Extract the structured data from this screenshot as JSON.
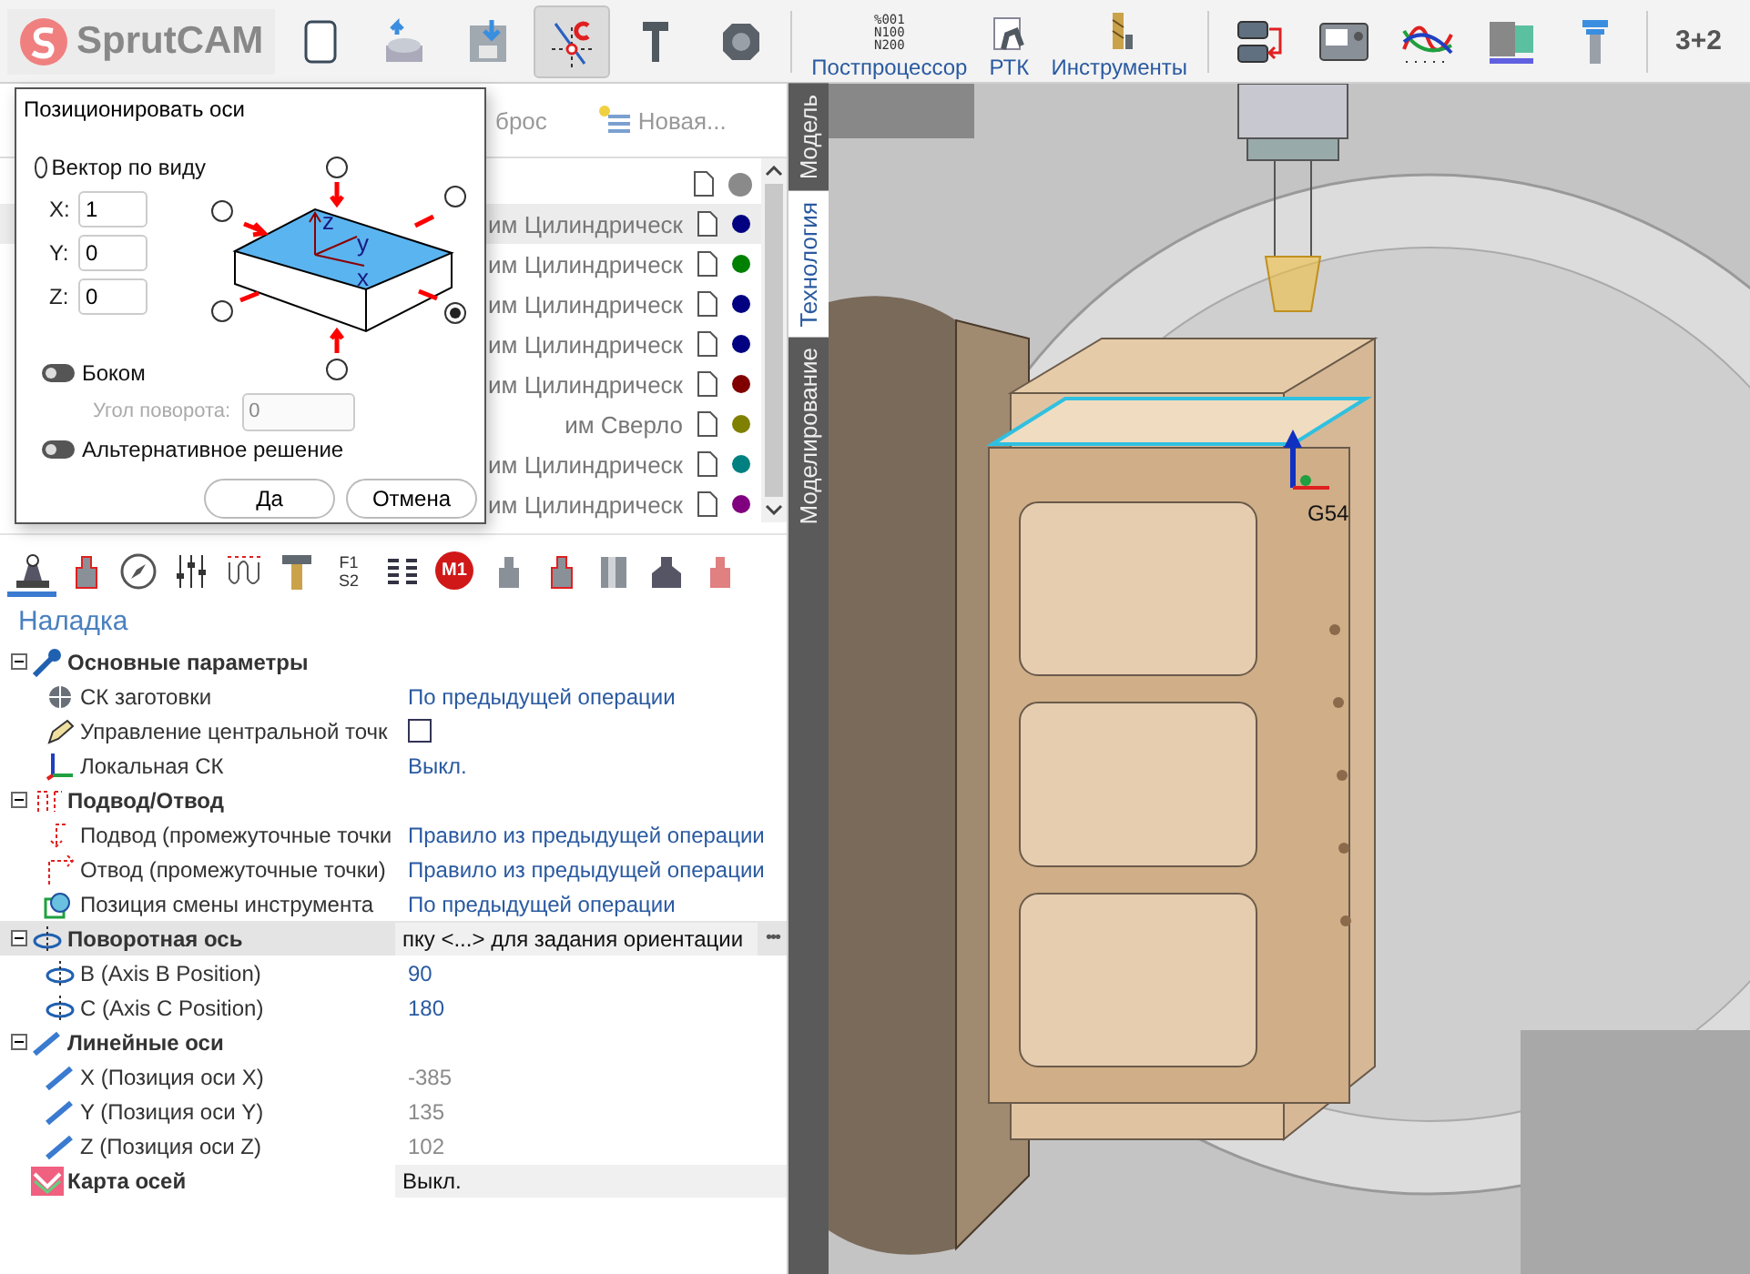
{
  "toolbar": {
    "logo": "SprutCAM",
    "tools": [
      {
        "kind": "new",
        "selected": false
      },
      {
        "kind": "open",
        "selected": false
      },
      {
        "kind": "save",
        "selected": false
      },
      {
        "kind": "snap",
        "selected": true
      },
      {
        "kind": "caliper",
        "selected": false
      },
      {
        "kind": "tape",
        "selected": false
      }
    ],
    "labeled": [
      {
        "kind": "post",
        "label": "Постпроцессор",
        "icon_lines": [
          "%001",
          "N100",
          "N200"
        ]
      },
      {
        "kind": "rtk",
        "label": "РТК"
      },
      {
        "kind": "tools",
        "label": "Инструменты"
      }
    ],
    "right_tools": [
      {
        "kind": "swap"
      },
      {
        "kind": "cnc"
      },
      {
        "kind": "curves"
      },
      {
        "kind": "spectrum"
      },
      {
        "kind": "tool"
      }
    ],
    "mode": "3+2"
  },
  "operations_panel": {
    "reset_label": "брос",
    "new_label": "Новая...",
    "header": {
      "color": "#8a8a8a"
    },
    "rows": [
      {
        "name": "им Цилиндрическ",
        "color": "#000080",
        "selected": true
      },
      {
        "name": "им Цилиндрическ",
        "color": "#008000",
        "selected": false
      },
      {
        "name": "им Цилиндрическ",
        "color": "#000080",
        "selected": false
      },
      {
        "name": "им Цилиндрическ",
        "color": "#000080",
        "selected": false
      },
      {
        "name": "им Цилиндрическ",
        "color": "#800000",
        "selected": false
      },
      {
        "name": "им Сверло",
        "color": "#808000",
        "selected": false
      },
      {
        "name": "им Цилиндрическ",
        "color": "#008080",
        "selected": false
      },
      {
        "name": "им Цилиндрическ",
        "color": "#800080",
        "selected": false
      }
    ]
  },
  "dialog": {
    "title": "Позиционировать оси",
    "view_vector": {
      "label": "Вектор по виду",
      "selected": false
    },
    "fields": [
      {
        "label": "X:",
        "value": "1"
      },
      {
        "label": "Y:",
        "value": "0"
      },
      {
        "label": "Z:",
        "value": "0"
      }
    ],
    "axis_labels": [
      "z",
      "y",
      "x"
    ],
    "directions": [
      {
        "selected": false
      },
      {
        "selected": false
      },
      {
        "selected": false
      },
      {
        "selected": false
      },
      {
        "selected": true
      },
      {
        "selected": false
      }
    ],
    "side": {
      "label": "Боком",
      "on": false
    },
    "angle": {
      "label": "Угол поворота:",
      "value": "0",
      "disabled": true
    },
    "alternative": {
      "label": "Альтернативное решение",
      "on": false
    },
    "buttons": [
      "Да",
      "Отмена"
    ]
  },
  "param_tabs": [
    {
      "selected": true
    },
    {
      "selected": false
    },
    {
      "selected": false
    },
    {
      "selected": false
    },
    {
      "selected": false
    },
    {
      "selected": false
    },
    {
      "selected": false,
      "labels": [
        "F1",
        "S2"
      ]
    },
    {
      "selected": false
    },
    {
      "selected": false,
      "labels": [
        "M1"
      ]
    },
    {
      "selected": false
    },
    {
      "selected": false
    },
    {
      "selected": false
    },
    {
      "selected": false
    },
    {
      "selected": false
    }
  ],
  "section_title": "Наладка",
  "properties": [
    {
      "kind": "group",
      "name": "Основные параметры",
      "expanded": true,
      "selected": false,
      "children": [
        {
          "name": "СК заготовки",
          "kind": "text",
          "value": "По предыдущей операции",
          "disabled": false
        },
        {
          "name": "Управление центральной точк",
          "kind": "checkbox",
          "checked": false
        },
        {
          "name": "Локальная СК",
          "kind": "text",
          "value": "Выкл.",
          "disabled": false
        }
      ]
    },
    {
      "kind": "group",
      "name": "Подвод/Отвод",
      "expanded": true,
      "selected": false,
      "children": [
        {
          "name": "Подвод (промежуточные точки",
          "kind": "text",
          "value": "Правило из предыдущей операции",
          "disabled": false
        },
        {
          "name": "Отвод (промежуточные точки)",
          "kind": "text",
          "value": "Правило из предыдущей операции",
          "disabled": false
        },
        {
          "name": "Позиция смены инструмента",
          "kind": "text",
          "value": "По предыдущей операции",
          "disabled": false
        }
      ]
    },
    {
      "kind": "group",
      "name": "Поворотная ось",
      "expanded": true,
      "selected": true,
      "value": "пку <...> для задания ориентации",
      "action": "•••",
      "children": [
        {
          "name": "B (Axis B Position)",
          "kind": "text",
          "value": "90",
          "disabled": false
        },
        {
          "name": "C (Axis C Position)",
          "kind": "text",
          "value": "180",
          "disabled": false
        }
      ]
    },
    {
      "kind": "group",
      "name": "Линейные оси",
      "expanded": true,
      "selected": false,
      "children": [
        {
          "name": "X (Позиция оси X)",
          "kind": "text",
          "value": "-385",
          "disabled": true
        },
        {
          "name": "Y (Позиция оси Y)",
          "kind": "text",
          "value": "135",
          "disabled": true
        },
        {
          "name": "Z (Позиция оси Z)",
          "kind": "text",
          "value": "102",
          "disabled": true
        }
      ]
    },
    {
      "kind": "leaf",
      "name": "Карта осей",
      "value": "Выкл.",
      "selected": false
    }
  ],
  "view_tabs": [
    {
      "label": "Модель",
      "selected": false
    },
    {
      "label": "Технология",
      "selected": true
    },
    {
      "label": "Моделирование",
      "selected": false
    }
  ],
  "viewport": {
    "origin_label": "G54"
  }
}
